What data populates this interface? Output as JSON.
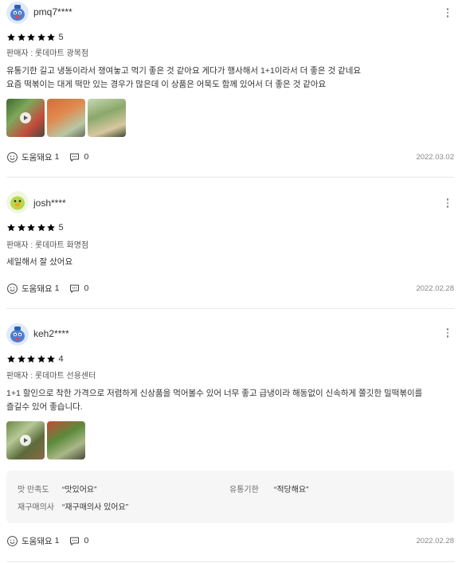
{
  "colors": {
    "star_on": "#f5a623",
    "star_off": "#d6d6d6",
    "divider": "#e9e9e9",
    "survey_bg": "#f6f6f6"
  },
  "actions": {
    "helpful_label": "도움돼요",
    "more_icon": "more-vertical-icon"
  },
  "reviews": [
    {
      "username": "pmq7****",
      "avatar": "blue-mascot-avatar",
      "rating": 5,
      "rating_text": "5",
      "seller": "판매자 : 롯데마트 광복점",
      "body_line1": "유통기한 길고 냉동이라서 쟁여놓고 먹기 좋은 것 같아요 게다가 행사해서 1+1이라서 더 좋은 것 같네요",
      "body_line2": "요즘 떡볶이는 대게 떡만 있는 경우가 많은데 이 상품은 어묵도 함께 있어서 더 좋은 것 같아요",
      "images": [
        "photo-video",
        "photo",
        "photo"
      ],
      "helpful_count": "1",
      "comment_count": "0",
      "date": "2022.03.02"
    },
    {
      "username": "josh****",
      "avatar": "green-duck-avatar",
      "rating": 5,
      "rating_text": "5",
      "seller": "판매자 : 롯데마트 화명점",
      "body_line1": "세일해서 잘 샀어요",
      "helpful_count": "1",
      "comment_count": "0",
      "date": "2022.02.28"
    },
    {
      "username": "keh2****",
      "avatar": "blue-mascot-avatar",
      "rating": 4,
      "rating_text": "4",
      "seller": "판매자 : 롯데마트 선용센터",
      "body_line1": "1+1 할인으로 착한 가격으로 저렴하게 신상품을 먹어볼수 있어 너무 좋고 급냉이라 해동없이 신속하게 쫄깃한 밀떡볶이를",
      "body_line2": "즐길수 있어 좋습니다.",
      "images": [
        "photo-video",
        "photo"
      ],
      "survey": [
        {
          "label": "맛 만족도",
          "value": "“맛있어요”"
        },
        {
          "label": "유통기한",
          "value": "“적당해요”"
        },
        {
          "label": "재구매의사",
          "value": "“재구매의사 있어요”"
        }
      ],
      "helpful_count": "1",
      "comment_count": "0",
      "date": "2022.02.28"
    }
  ]
}
